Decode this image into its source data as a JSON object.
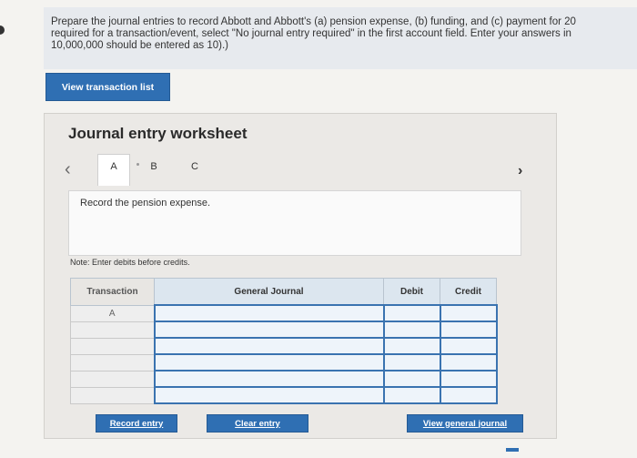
{
  "instructions": {
    "line1": "Prepare the journal entries to record Abbott and Abbott's (a) pension expense, (b) funding, and (c) payment for 20",
    "line2": "required for a transaction/event, select \"No journal entry required\" in the first account field. Enter your answers in",
    "line3": "10,000,000 should be entered as 10).)"
  },
  "view_transaction_button": "View transaction list",
  "worksheet": {
    "title": "Journal entry worksheet",
    "tabs": [
      "A",
      "B",
      "C"
    ],
    "active_tab": "A",
    "description": "Record the pension expense.",
    "note": "Note: Enter debits before credits.",
    "columns": {
      "transaction": "Transaction",
      "general_journal": "General Journal",
      "debit": "Debit",
      "credit": "Credit"
    },
    "rows": [
      {
        "transaction": "A",
        "account": "",
        "debit": "",
        "credit": ""
      },
      {
        "transaction": "",
        "account": "",
        "debit": "",
        "credit": ""
      },
      {
        "transaction": "",
        "account": "",
        "debit": "",
        "credit": ""
      },
      {
        "transaction": "",
        "account": "",
        "debit": "",
        "credit": ""
      },
      {
        "transaction": "",
        "account": "",
        "debit": "",
        "credit": ""
      },
      {
        "transaction": "",
        "account": "",
        "debit": "",
        "credit": ""
      }
    ],
    "buttons": {
      "record": "Record entry",
      "clear": "Clear entry",
      "view_journal": "View general journal"
    }
  },
  "icons": {
    "prev": "chevron-left-icon",
    "next": "chevron-right-icon"
  }
}
